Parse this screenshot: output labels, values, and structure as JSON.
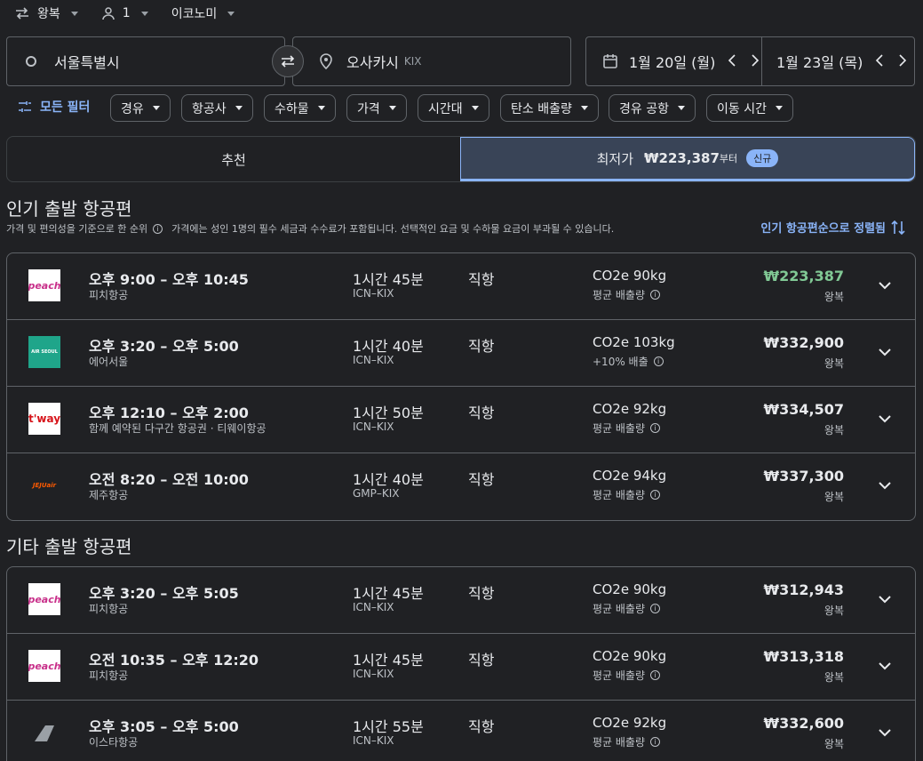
{
  "topbar": {
    "trip_type": "왕복",
    "passengers": "1",
    "cabin": "이코노미"
  },
  "search": {
    "origin": "서울특별시",
    "destination": "오사카시",
    "destination_code": "KIX",
    "depart_date": "1월 20일 (월)",
    "return_date": "1월 23일 (목)"
  },
  "filters": {
    "all_filters": "모든 필터",
    "chips": [
      "경유",
      "항공사",
      "수하물",
      "가격",
      "시간대",
      "탄소 배출량",
      "경유 공항",
      "이동 시간"
    ]
  },
  "tabs": {
    "recommended": "추천",
    "cheapest_label": "최저가",
    "cheapest_price": "₩223,387",
    "cheapest_suffix": "부터",
    "new_badge": "신규"
  },
  "popular": {
    "title": "인기 출발 항공편",
    "subtext": "가격 및 편의성을 기준으로 한 순위",
    "subtext2": "가격에는 성인 1명의 필수 세금과 수수료가 포함됩니다. 선택적인 요금 및 수하물 요금이 부과될 수 있습니다.",
    "sort_label": "인기 항공편순으로 정렬됨",
    "flights": [
      {
        "times": "오후 9:00 – 오후 10:45",
        "airline": "피치항공",
        "duration": "1시간 45분",
        "route": "ICN–KIX",
        "stops": "직항",
        "co2": "CO2e 90kg",
        "co2sub": "평균 배출량",
        "price": "₩223,387",
        "price_sub": "왕복",
        "logo": "peach"
      },
      {
        "times": "오후 3:20 – 오후 5:00",
        "airline": "에어서울",
        "duration": "1시간 40분",
        "route": "ICN–KIX",
        "stops": "직항",
        "co2": "CO2e 103kg",
        "co2sub": "+10% 배출",
        "price": "₩332,900",
        "price_sub": "왕복",
        "logo": "AIR SEOUL"
      },
      {
        "times": "오후 12:10 – 오후 2:00",
        "airline": "함께 예약된 다구간 항공권 · 티웨이항공",
        "duration": "1시간 50분",
        "route": "ICN–KIX",
        "stops": "직항",
        "co2": "CO2e 92kg",
        "co2sub": "평균 배출량",
        "price": "₩334,507",
        "price_sub": "왕복",
        "logo": "t'way"
      },
      {
        "times": "오전 8:20 – 오전 10:00",
        "airline": "제주항공",
        "duration": "1시간 40분",
        "route": "GMP–KIX",
        "stops": "직항",
        "co2": "CO2e 94kg",
        "co2sub": "평균 배출량",
        "price": "₩337,300",
        "price_sub": "왕복",
        "logo": "JEJUair"
      }
    ]
  },
  "other": {
    "title": "기타 출발 항공편",
    "flights": [
      {
        "times": "오후 3:20 – 오후 5:05",
        "airline": "피치항공",
        "duration": "1시간 45분",
        "route": "ICN–KIX",
        "stops": "직항",
        "co2": "CO2e 90kg",
        "co2sub": "평균 배출량",
        "price": "₩312,943",
        "price_sub": "왕복",
        "logo": "peach"
      },
      {
        "times": "오전 10:35 – 오후 12:20",
        "airline": "피치항공",
        "duration": "1시간 45분",
        "route": "ICN–KIX",
        "stops": "직항",
        "co2": "CO2e 90kg",
        "co2sub": "평균 배출량",
        "price": "₩313,318",
        "price_sub": "왕복",
        "logo": "peach"
      },
      {
        "times": "오후 3:05 – 오후 5:00",
        "airline": "이스타항공",
        "duration": "1시간 55분",
        "route": "ICN–KIX",
        "stops": "직항",
        "co2": "CO2e 92kg",
        "co2sub": "평균 배출량",
        "price": "₩332,600",
        "price_sub": "왕복",
        "logo": ""
      }
    ]
  },
  "colors": {
    "background": "#202124",
    "accent": "#8ab4f8",
    "price_green": "#81c995",
    "peach": "#c8308a",
    "airseoul": "#1fa58a",
    "tway": "#d7141a",
    "jeju": "#ff5a00"
  }
}
